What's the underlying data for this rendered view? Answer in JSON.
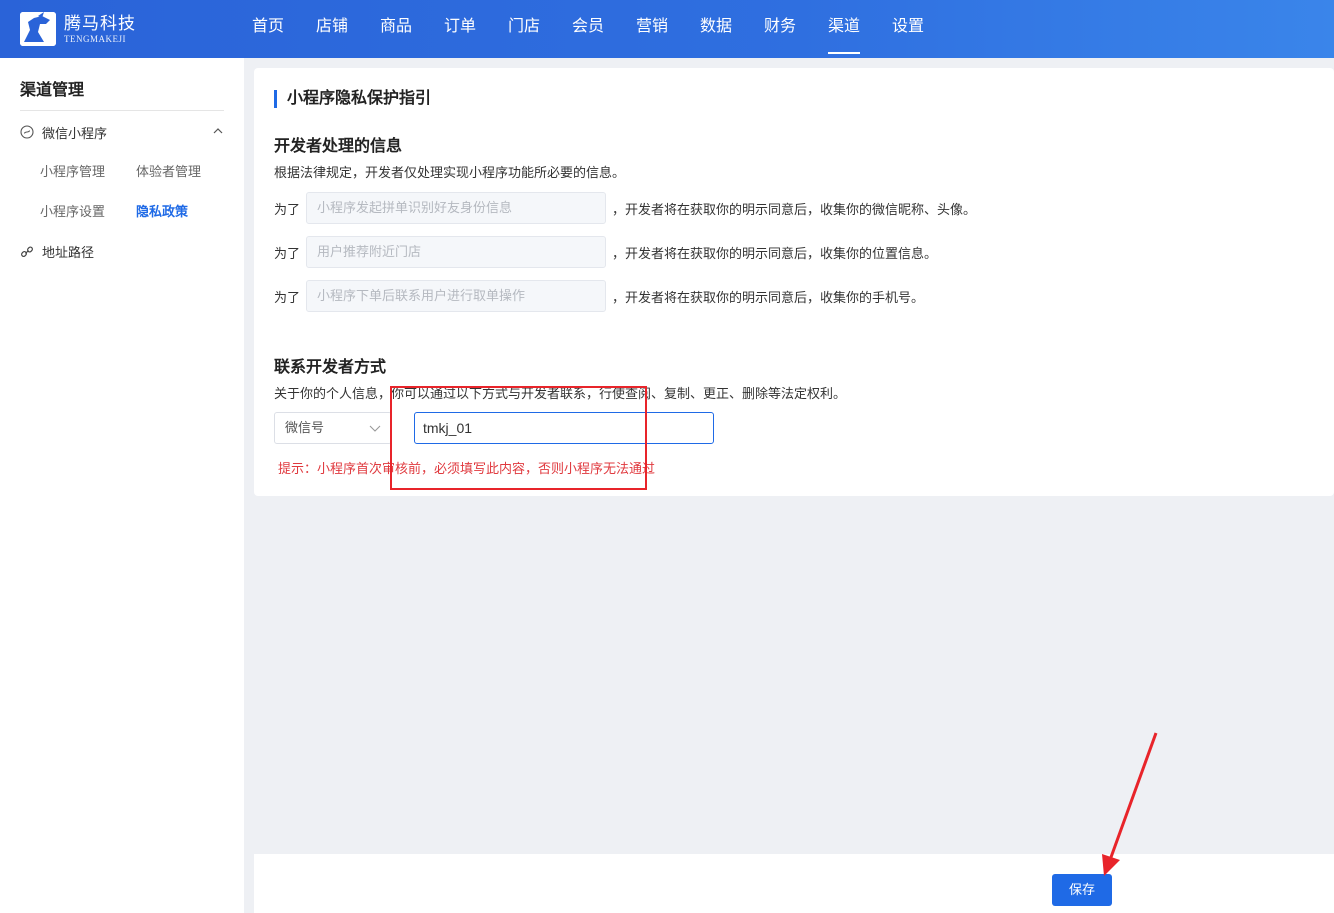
{
  "brand": {
    "name_cn": "腾马科技",
    "name_en": "TENGMAKEJI",
    "color": "#2a63d8"
  },
  "nav": {
    "items": [
      {
        "label": "首页"
      },
      {
        "label": "店铺"
      },
      {
        "label": "商品"
      },
      {
        "label": "订单"
      },
      {
        "label": "门店"
      },
      {
        "label": "会员"
      },
      {
        "label": "营销"
      },
      {
        "label": "数据"
      },
      {
        "label": "财务"
      },
      {
        "label": "渠道",
        "active": true
      },
      {
        "label": "设置"
      }
    ]
  },
  "sidebar": {
    "title": "渠道管理",
    "group": {
      "label": "微信小程序",
      "icon": "miniprogram-icon",
      "expanded": true
    },
    "subitems": [
      {
        "label": "小程序管理"
      },
      {
        "label": "体验者管理"
      },
      {
        "label": "小程序设置"
      },
      {
        "label": "隐私政策",
        "active": true
      }
    ],
    "path_item": {
      "label": "地址路径",
      "icon": "link-icon"
    }
  },
  "main": {
    "title": "小程序隐私保护指引",
    "dev_info": {
      "title": "开发者处理的信息",
      "desc": "根据法律规定，开发者仅处理实现小程序功能所必要的信息。",
      "rows": [
        {
          "prefix": "为了",
          "placeholder": "小程序发起拼单识别好友身份信息",
          "suffix": "，开发者将在获取你的明示同意后，收集你的微信昵称、头像。"
        },
        {
          "prefix": "为了",
          "placeholder": "用户推荐附近门店",
          "suffix": "，开发者将在获取你的明示同意后，收集你的位置信息。"
        },
        {
          "prefix": "为了",
          "placeholder": "小程序下单后联系用户进行取单操作",
          "suffix": "，开发者将在获取你的明示同意后，收集你的手机号。"
        }
      ]
    },
    "contact": {
      "title": "联系开发者方式",
      "desc": "关于你的个人信息，你可以通过以下方式与开发者联系，行使查阅、复制、更正、删除等法定权利。",
      "type_selected": "微信号",
      "value": "tmkj_01",
      "hint": "提示：小程序首次审核前，必须填写此内容，否则小程序无法通过"
    }
  },
  "footer": {
    "save_label": "保存"
  },
  "colors": {
    "primary": "#1f6ae6",
    "danger": "#e0393e",
    "annotation": "#e8242a"
  }
}
